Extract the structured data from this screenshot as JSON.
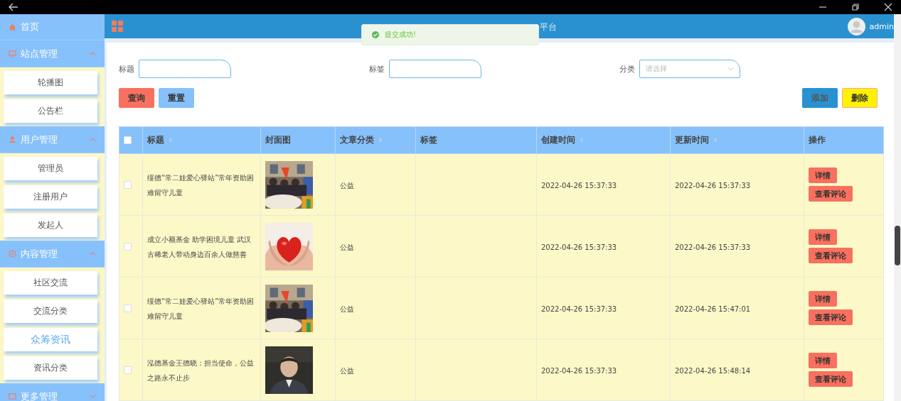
{
  "sidebar": {
    "items": [
      {
        "label": "首页",
        "kind": "link"
      },
      {
        "label": "站点管理",
        "kind": "group",
        "expanded": true,
        "children": [
          {
            "label": "轮播图",
            "selected": false
          },
          {
            "label": "公告栏",
            "selected": false
          }
        ]
      },
      {
        "label": "用户管理",
        "kind": "group",
        "expanded": true,
        "children": [
          {
            "label": "管理员",
            "selected": false
          },
          {
            "label": "注册用户",
            "selected": false
          },
          {
            "label": "发起人",
            "selected": false
          }
        ]
      },
      {
        "label": "内容管理",
        "kind": "group",
        "expanded": true,
        "children": [
          {
            "label": "社区交流",
            "selected": false
          },
          {
            "label": "交流分类",
            "selected": false
          },
          {
            "label": "众筹资讯",
            "selected": true
          },
          {
            "label": "资讯分类",
            "selected": false
          }
        ]
      },
      {
        "label": "更多管理",
        "kind": "group",
        "expanded": false
      }
    ]
  },
  "header": {
    "title": "平台",
    "user": "admin"
  },
  "toast": {
    "message": "提交成功!"
  },
  "filters": [
    {
      "label": "标题",
      "kind": "text"
    },
    {
      "label": "标签",
      "kind": "text"
    },
    {
      "label": "分类",
      "kind": "select",
      "placeholder": "请选择"
    }
  ],
  "actions_left": [
    {
      "label": "查询",
      "kind": "danger"
    },
    {
      "label": "重置",
      "kind": "info"
    }
  ],
  "actions_right": [
    {
      "label": "添加",
      "kind": "primary"
    },
    {
      "label": "删除",
      "kind": "warning"
    }
  ],
  "table": {
    "columns": [
      {
        "label": "标题",
        "sortable": true
      },
      {
        "label": "封面图",
        "sortable": false
      },
      {
        "label": "文章分类",
        "sortable": true
      },
      {
        "label": "标签",
        "sortable": false
      },
      {
        "label": "创建时间",
        "sortable": true
      },
      {
        "label": "更新时间",
        "sortable": true
      },
      {
        "label": "操作",
        "sortable": false
      }
    ],
    "header_checked": false,
    "rows": [
      {
        "checked": false,
        "title": "绥德“常二娃爱心驿站”常年资助困难留守儿童",
        "cover": {
          "kind": "crowd"
        },
        "category": "公益",
        "created": "2022-04-26 15:37:33",
        "updated": "2022-04-26 15:37:33",
        "buttons": [
          "详情",
          "查看评论"
        ]
      },
      {
        "checked": false,
        "title": "成立小额基金 助学困境儿童 武汉古稀老人带动身边百余人做慈善",
        "cover": {
          "kind": "heart"
        },
        "category": "公益",
        "created": "2022-04-26 15:37:33",
        "updated": "2022-04-26 15:37:33",
        "buttons": [
          "详情",
          "查看评论"
        ]
      },
      {
        "checked": false,
        "title": "绥德“常二娃爱心驿站”常年资助困难留守儿童",
        "cover": {
          "kind": "crowd"
        },
        "category": "公益",
        "created": "2022-04-26 15:37:33",
        "updated": "2022-04-26 15:47:01",
        "buttons": [
          "详情",
          "查看评论"
        ]
      },
      {
        "checked": false,
        "title": "泓德基金王德晓：担当使命，公益之路永不止步",
        "cover": {
          "kind": "portrait"
        },
        "category": "公益",
        "created": "2022-04-26 15:37:33",
        "updated": "2022-04-26 15:48:14",
        "buttons": [
          "详情",
          "查看评论"
        ]
      }
    ]
  }
}
